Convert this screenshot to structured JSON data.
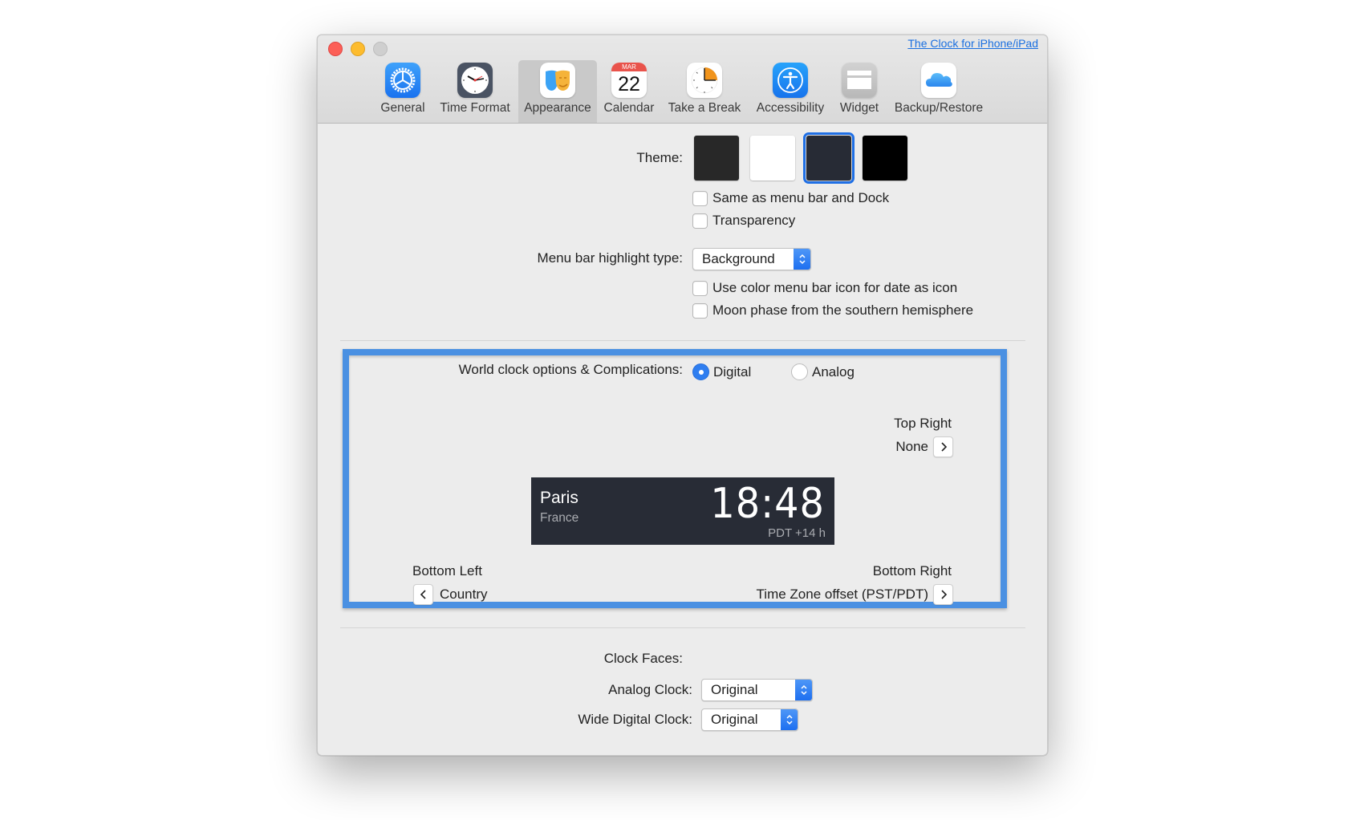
{
  "window": {
    "link": "The Clock for iPhone/iPad",
    "traffic_lights": [
      "close",
      "minimize",
      "zoom"
    ]
  },
  "tabs": [
    {
      "label": "General",
      "icon": "gear-icon"
    },
    {
      "label": "Time Format",
      "icon": "clock-icon"
    },
    {
      "label": "Appearance",
      "icon": "theater-masks-icon",
      "selected": true
    },
    {
      "label": "Calendar",
      "icon": "calendar-icon",
      "month": "MAR",
      "day": "22"
    },
    {
      "label": "Take a Break",
      "icon": "break-timer-icon"
    },
    {
      "label": "Accessibility",
      "icon": "accessibility-icon"
    },
    {
      "label": "Widget",
      "icon": "widget-icon"
    },
    {
      "label": "Backup/Restore",
      "icon": "icloud-icon"
    }
  ],
  "theme": {
    "label": "Theme:",
    "swatches": [
      {
        "name": "dark-gray",
        "color": "#282828"
      },
      {
        "name": "white",
        "color": "#ffffff"
      },
      {
        "name": "navy-dark",
        "color": "#272b35",
        "selected": true
      },
      {
        "name": "black",
        "color": "#000000"
      }
    ],
    "options": [
      {
        "label": "Same as menu bar and Dock",
        "checked": false
      },
      {
        "label": "Transparency",
        "checked": false
      }
    ]
  },
  "menubar": {
    "label": "Menu bar highlight type:",
    "value": "Background",
    "options": [
      {
        "label": "Use color menu bar icon for date as icon",
        "checked": false
      },
      {
        "label": "Moon phase from the southern hemisphere",
        "checked": false
      }
    ]
  },
  "world_clock": {
    "label": "World clock options & Complications:",
    "modes": [
      {
        "label": "Digital",
        "selected": true
      },
      {
        "label": "Analog",
        "selected": false
      }
    ],
    "top_right": {
      "title": "Top Right",
      "value": "None"
    },
    "bottom_left": {
      "title": "Bottom Left",
      "value": "Country"
    },
    "bottom_right": {
      "title": "Bottom Right",
      "value": "Time Zone offset (PST/PDT)"
    },
    "preview": {
      "city": "Paris",
      "country": "France",
      "time": "18:48",
      "offset": "PDT +14 h"
    },
    "highlight_color": "#4a90e2"
  },
  "clock_faces": {
    "label": "Clock Faces:",
    "analog": {
      "label": "Analog Clock:",
      "value": "Original"
    },
    "wide_digital": {
      "label": "Wide Digital Clock:",
      "value": "Original"
    }
  }
}
